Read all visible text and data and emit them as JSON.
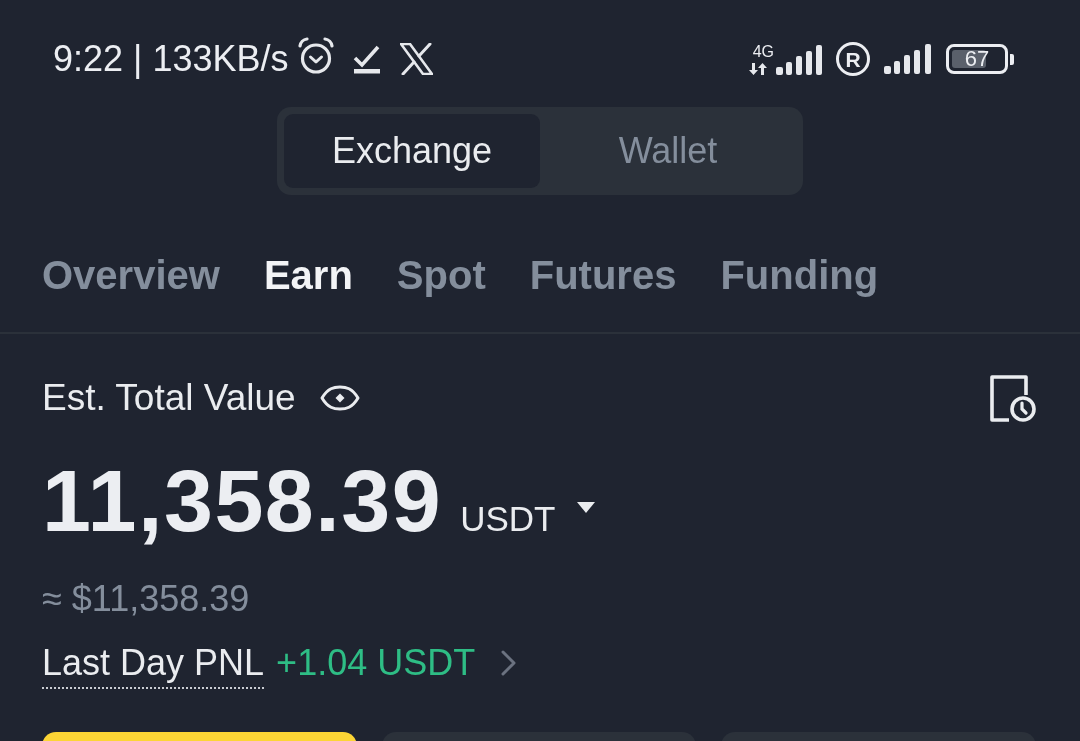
{
  "status_bar": {
    "text": "9:22 | 133KB/s",
    "network": "4G",
    "roaming_badge": "R",
    "battery": "67"
  },
  "segments": [
    {
      "label": "Exchange",
      "selected": true
    },
    {
      "label": "Wallet",
      "selected": false
    }
  ],
  "tabs": [
    {
      "label": "Overview",
      "selected": false
    },
    {
      "label": "Earn",
      "selected": true
    },
    {
      "label": "Spot",
      "selected": false
    },
    {
      "label": "Futures",
      "selected": false
    },
    {
      "label": "Funding",
      "selected": false
    }
  ],
  "summary": {
    "label": "Est. Total Value",
    "value": "11,358.39",
    "unit": "USDT",
    "approx": "≈ $11,358.39",
    "pnl_label": "Last Day PNL",
    "pnl_value": "+1.04 USDT",
    "pnl_positive": true
  },
  "action_buttons": [
    {
      "kind": "primary"
    },
    {
      "kind": "secondary"
    },
    {
      "kind": "secondary"
    }
  ]
}
